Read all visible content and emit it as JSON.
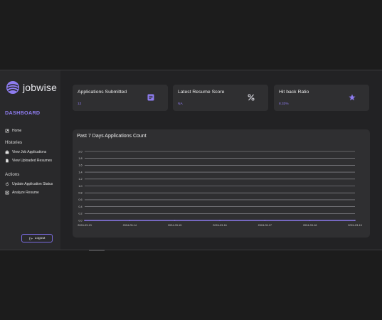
{
  "brand": {
    "name": "jobwise",
    "accent": "#8e7cf0"
  },
  "sidebar": {
    "heading": "DASHBOARD",
    "home": {
      "label": "Home",
      "icon": "home-icon"
    },
    "histories": {
      "label": "Histories",
      "items": [
        {
          "label": "View Job Applications",
          "icon": "briefcase-icon"
        },
        {
          "label": "View Uploaded Resumes",
          "icon": "file-icon"
        }
      ]
    },
    "actions": {
      "label": "Actions",
      "items": [
        {
          "label": "Update Application Status",
          "icon": "refresh-icon"
        },
        {
          "label": "Analyze Resume",
          "icon": "analyze-icon"
        }
      ]
    },
    "logout": {
      "label": "Logout",
      "icon": "logout-icon"
    }
  },
  "cards": [
    {
      "title": "Applications Submitted",
      "value": "12",
      "icon": "document-icon"
    },
    {
      "title": "Latest Resume Score",
      "value": "NA",
      "icon": "percent-icon"
    },
    {
      "title": "Hit back Ratio",
      "value": "8.33%",
      "icon": "star-icon"
    }
  ],
  "chart": {
    "title": "Past 7 Days Applications Count"
  },
  "chart_data": {
    "type": "line",
    "title": "Past 7 Days Applications Count",
    "categories": [
      "2024-03-13",
      "2024-03-14",
      "2024-03-15",
      "2024-03-16",
      "2024-03-17",
      "2024-03-18",
      "2024-03-19"
    ],
    "series": [
      {
        "values": [
          0,
          0,
          0,
          0,
          0,
          0,
          0
        ],
        "color": "#8e7cf0"
      }
    ],
    "yticks": [
      "0.0",
      "0.2",
      "0.4",
      "0.6",
      "0.8",
      "1.0",
      "1.2",
      "1.4",
      "1.6",
      "1.8",
      "2.0"
    ],
    "ylim": [
      0,
      2.0
    ],
    "grid": true
  }
}
